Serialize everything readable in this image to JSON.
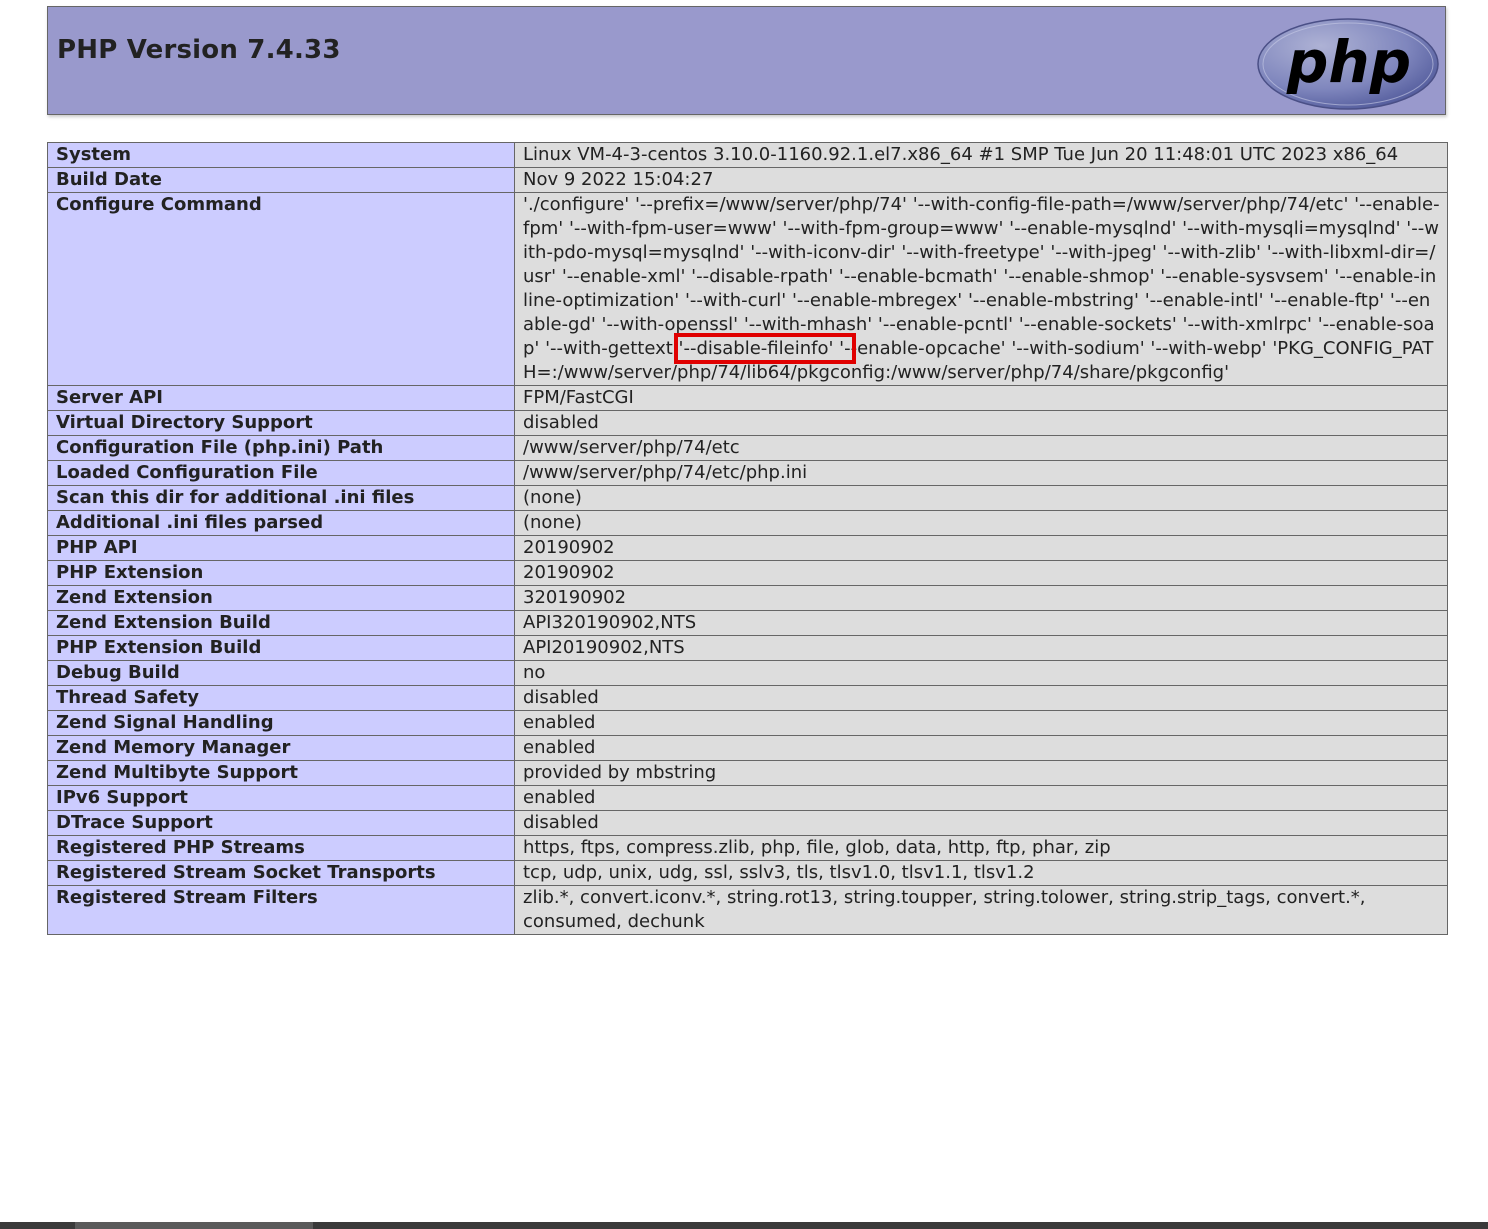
{
  "header": {
    "title": "PHP Version 7.4.33",
    "logo_text": "php"
  },
  "configure": {
    "before": "'./configure' '--prefix=/www/server/php/74' '--with-config-file-path=/www/server/php/74/etc' '--enable-fpm' '--with-fpm-user=www' '--with-fpm-group=www' '--enable-mysqlnd' '--with-mysqli=mysqlnd' '--with-pdo-mysql=mysqlnd' '--with-iconv-dir' '--with-freetype' '--with-jpeg' '--with-zlib' '--with-libxml-dir=/usr' '--enable-xml' '--disable-rpath' '--enable-bcmath' '--enable-shmop' '--enable-sysvsem' '--enable-inline-optimization' '--with-curl' '--enable-mbregex' '--enable-mbstring' '--enable-intl' '--enable-ftp' '--enable-gd' '--with-openssl' '--with-mhash' '--enable-pcntl' '--enable-sockets' '--with-xmlrpc' '--enable-soap' '--with-gettext ",
    "highlight": "'--disable-fileinfo' '-",
    "after": "-enable-opcache' '--with-sodium' '--with-webp' 'PKG_CONFIG_PATH=:/www/server/php/74/lib64/pkgconfig:/www/server/php/74/share/pkgconfig'"
  },
  "rows": [
    {
      "label": "System",
      "value": "Linux VM-4-3-centos 3.10.0-1160.92.1.el7.x86_64 #1 SMP Tue Jun 20 11:48:01 UTC 2023 x86_64"
    },
    {
      "label": "Build Date",
      "value": "Nov 9 2022 15:04:27"
    },
    {
      "label": "Configure Command",
      "value": ""
    },
    {
      "label": "Server API",
      "value": "FPM/FastCGI"
    },
    {
      "label": "Virtual Directory Support",
      "value": "disabled"
    },
    {
      "label": "Configuration File (php.ini) Path",
      "value": "/www/server/php/74/etc"
    },
    {
      "label": "Loaded Configuration File",
      "value": "/www/server/php/74/etc/php.ini"
    },
    {
      "label": "Scan this dir for additional .ini files",
      "value": "(none)"
    },
    {
      "label": "Additional .ini files parsed",
      "value": "(none)"
    },
    {
      "label": "PHP API",
      "value": "20190902"
    },
    {
      "label": "PHP Extension",
      "value": "20190902"
    },
    {
      "label": "Zend Extension",
      "value": "320190902"
    },
    {
      "label": "Zend Extension Build",
      "value": "API320190902,NTS"
    },
    {
      "label": "PHP Extension Build",
      "value": "API20190902,NTS"
    },
    {
      "label": "Debug Build",
      "value": "no"
    },
    {
      "label": "Thread Safety",
      "value": "disabled"
    },
    {
      "label": "Zend Signal Handling",
      "value": "enabled"
    },
    {
      "label": "Zend Memory Manager",
      "value": "enabled"
    },
    {
      "label": "Zend Multibyte Support",
      "value": "provided by mbstring"
    },
    {
      "label": "IPv6 Support",
      "value": "enabled"
    },
    {
      "label": "DTrace Support",
      "value": "disabled"
    },
    {
      "label": "Registered PHP Streams",
      "value": "https, ftps, compress.zlib, php, file, glob, data, http, ftp, phar, zip"
    },
    {
      "label": "Registered Stream Socket Transports",
      "value": "tcp, udp, unix, udg, ssl, sslv3, tls, tlsv1.0, tlsv1.1, tlsv1.2"
    },
    {
      "label": "Registered Stream Filters",
      "value": "zlib.*, convert.iconv.*, string.rot13, string.toupper, string.tolower, string.strip_tags, convert.*, consumed, dechunk"
    }
  ],
  "colors": {
    "header_bg": "#9999cc",
    "label_bg": "#ccccff",
    "value_bg": "#dddddd",
    "highlight_box": "#e00000"
  }
}
